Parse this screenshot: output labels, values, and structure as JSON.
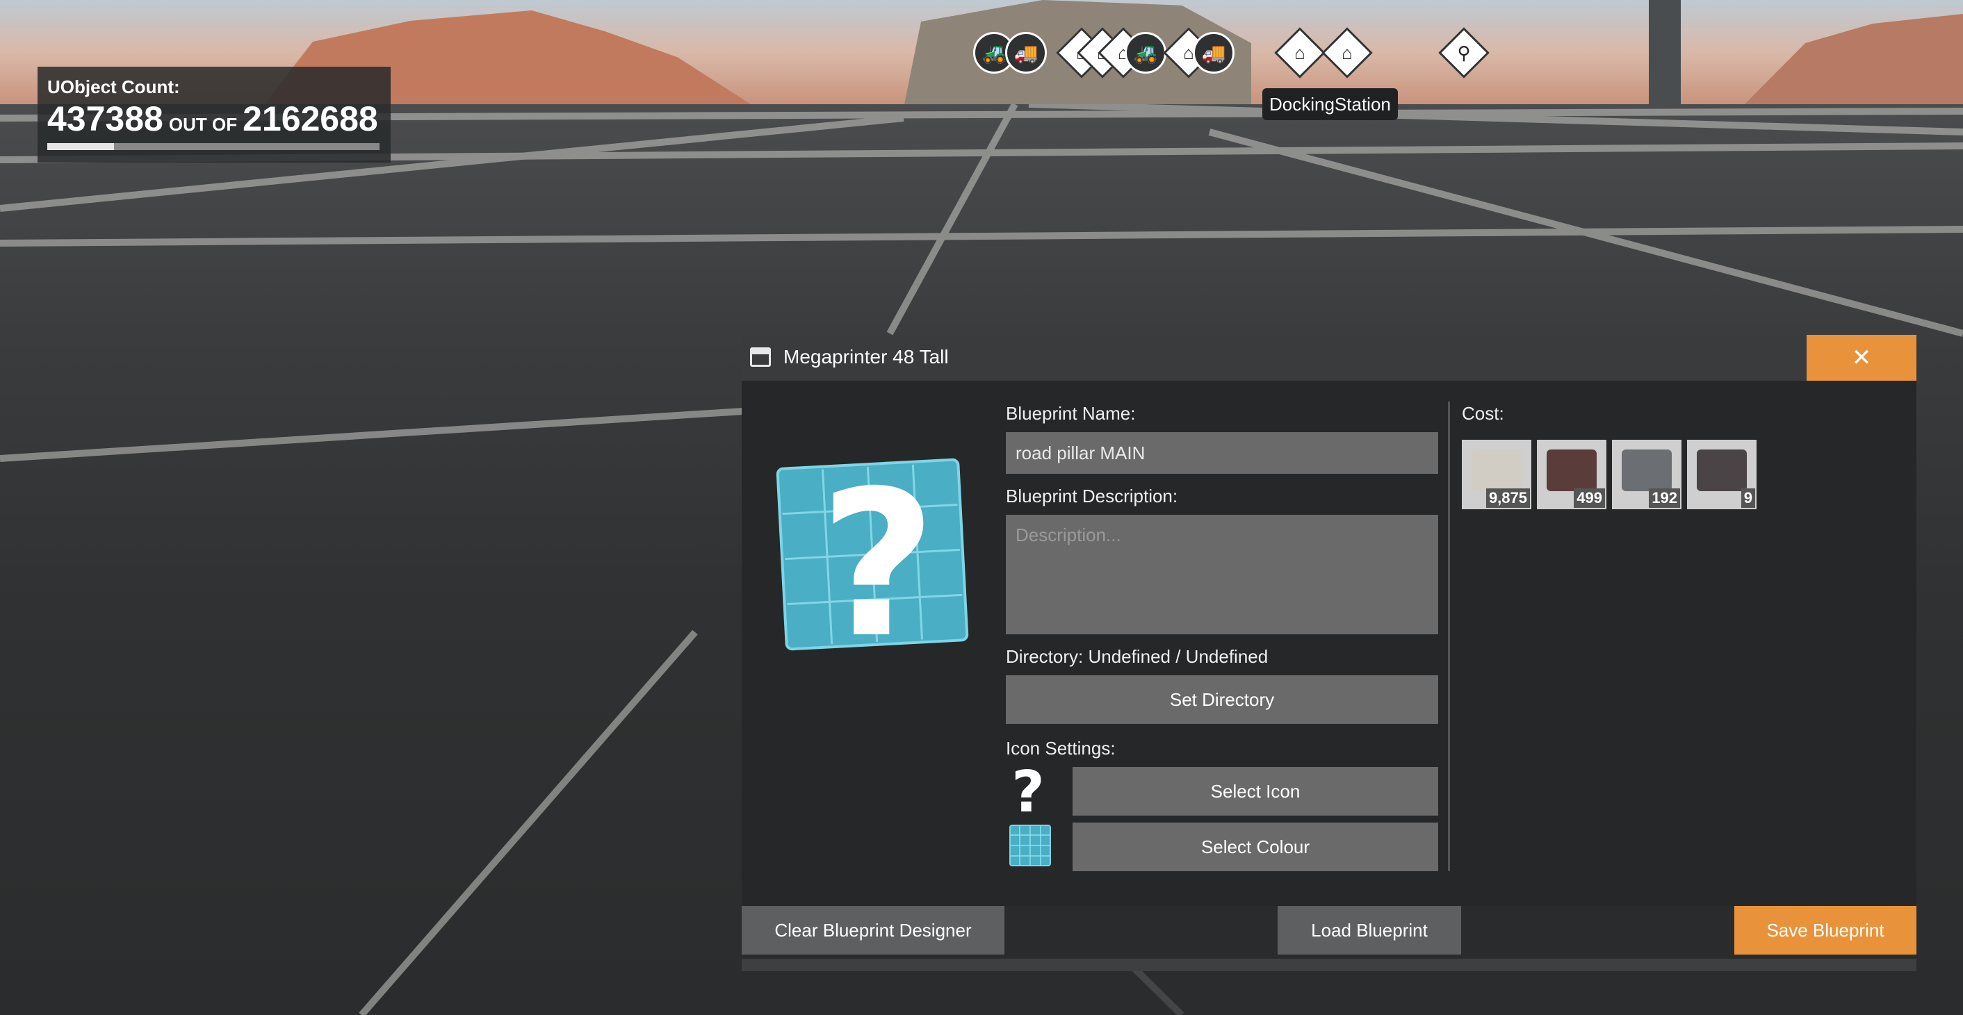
{
  "hud": {
    "label": "UObject Count:",
    "current": "437388",
    "separator": "OUT OF",
    "max": "2162688",
    "fill_fraction": 0.2
  },
  "compass": {
    "tooltip": "DockingStation",
    "markers": [
      {
        "kind": "circle",
        "icon": "truck-icon",
        "glyph": "🚜"
      },
      {
        "kind": "circle",
        "icon": "truck-icon",
        "glyph": "🚚"
      },
      {
        "kind": "diamond",
        "icon": "station-icon",
        "glyph": "⌂"
      },
      {
        "kind": "diamond",
        "icon": "station-icon",
        "glyph": "⌂"
      },
      {
        "kind": "diamond",
        "icon": "station-icon",
        "glyph": "⌂"
      },
      {
        "kind": "circle",
        "icon": "truck-icon",
        "glyph": "🚜"
      },
      {
        "kind": "diamond",
        "icon": "home-icon",
        "glyph": "⌂"
      },
      {
        "kind": "circle",
        "icon": "truck-icon",
        "glyph": "🚚"
      },
      {
        "kind": "diamond",
        "icon": "station-icon",
        "glyph": "⌂"
      },
      {
        "kind": "diamond",
        "icon": "docking-station-icon",
        "glyph": "⌂"
      },
      {
        "kind": "diamond",
        "icon": "tower-icon",
        "glyph": "⚲"
      }
    ]
  },
  "dialog": {
    "title": "Megaprinter 48 Tall",
    "close_glyph": "✕",
    "name_label": "Blueprint Name:",
    "name_value": "road pillar MAIN",
    "description_label": "Blueprint Description:",
    "description_placeholder": "Description...",
    "directory_label": "Directory: Undefined / Undefined",
    "set_directory": "Set Directory",
    "icon_settings_label": "Icon Settings:",
    "select_icon": "Select Icon",
    "select_colour": "Select Colour",
    "cost_label": "Cost:",
    "cost_items": [
      {
        "name": "concrete-icon",
        "quantity": "9,875"
      },
      {
        "name": "steel-beam-icon",
        "quantity": "499"
      },
      {
        "name": "steel-pipe-icon",
        "quantity": "192"
      },
      {
        "name": "encased-beam-icon",
        "quantity": "9"
      }
    ],
    "icon_color": "#4aaec4",
    "accent_color": "#e8933b"
  },
  "footer": {
    "clear": "Clear Blueprint Designer",
    "load": "Load Blueprint",
    "save": "Save Blueprint"
  }
}
